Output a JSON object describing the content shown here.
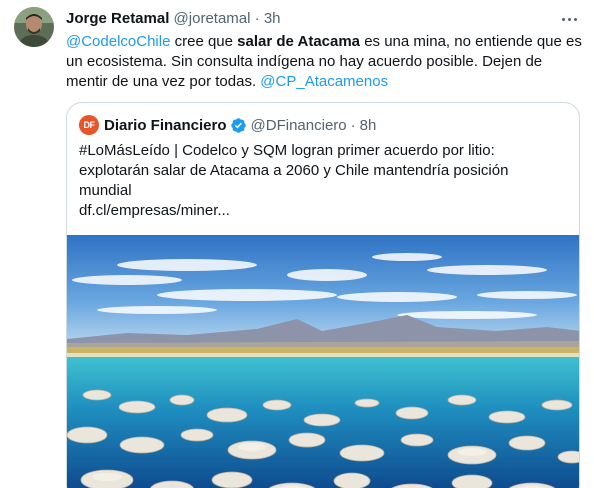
{
  "tweet": {
    "display_name": "Jorge Retamal",
    "handle": "@joretamal",
    "separator": "·",
    "time": "3h",
    "more_icon": "more-horizontal-icon",
    "text": {
      "mention1": "@CodelcoChile",
      "part1": " cree que ",
      "bold": "salar de Atacama",
      "part2": " es una mina, no entiende que es un ecosistema. Sin consulta indígena no hay acuerdo posible. Dejen de mentir de una vez por todas. ",
      "mention2": "@CP_Atacamenos"
    }
  },
  "quote": {
    "logo_text": "DF",
    "display_name": "Diario Financiero",
    "handle": "@DFinanciero",
    "separator": "·",
    "time": "8h",
    "verified_icon": "verified-badge-icon",
    "lines": [
      "#LoMásLeído | Codelco y SQM logran primer acuerdo por litio:",
      "explotarán salar de Atacama a 2060 y Chile mantendría posición",
      "mundial",
      "df.cl/empresas/miner..."
    ]
  },
  "colors": {
    "link": "#1d9bf0",
    "secondary_text": "#536471",
    "border": "#cfd9de",
    "df_brand": "#e8552b",
    "verified": "#1d9bf0"
  }
}
